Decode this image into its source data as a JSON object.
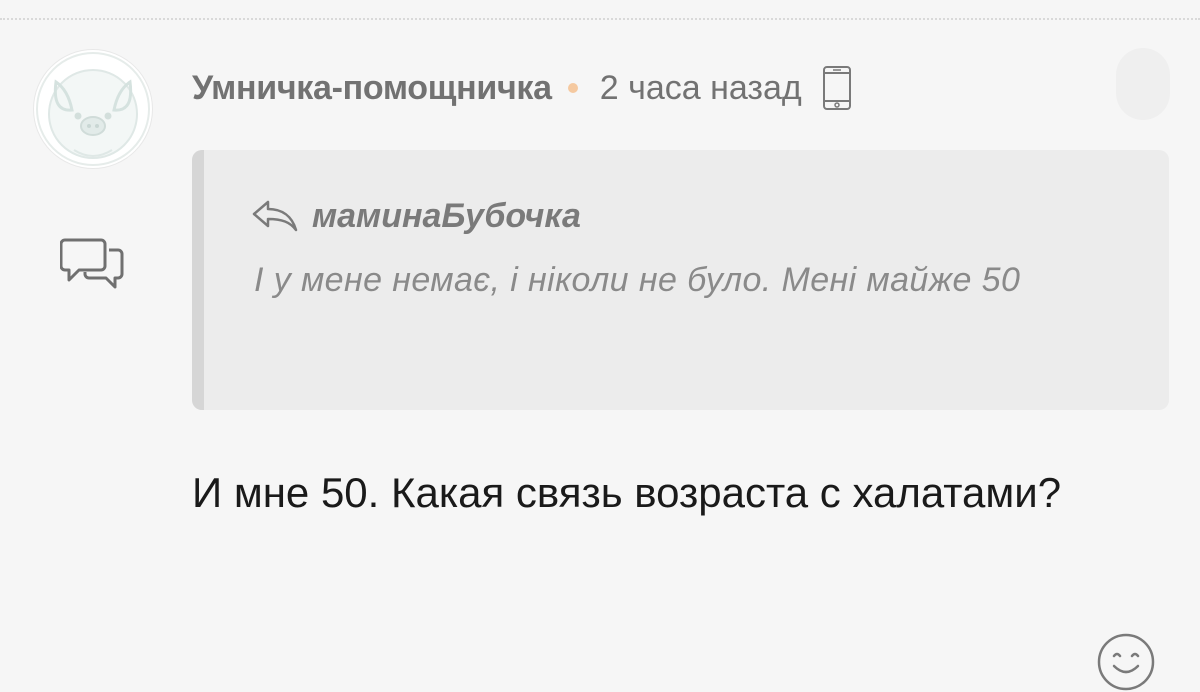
{
  "comment": {
    "author": "Умничка-помощничка",
    "time": "2 часа назад",
    "device_icon": "phone-icon",
    "avatar_icon": "pig-avatar",
    "side_icon": "chat-bubbles-icon",
    "quote": {
      "icon": "reply-arrow-icon",
      "author": "маминаБубочка",
      "text": "І у мене немає, і ніколи не було. Мені майже 50"
    },
    "message": "И мне 50. Какая связь возраста с халатами?",
    "reaction_icon": "smile-icon"
  },
  "colors": {
    "background": "#f6f6f6",
    "quote_bg": "#ececec",
    "quote_bar": "#d6d6d6",
    "dot": "#f5c9a0",
    "meta_text": "#727272",
    "quote_text": "#8a8a8a",
    "message_text": "#1a1a1a"
  }
}
